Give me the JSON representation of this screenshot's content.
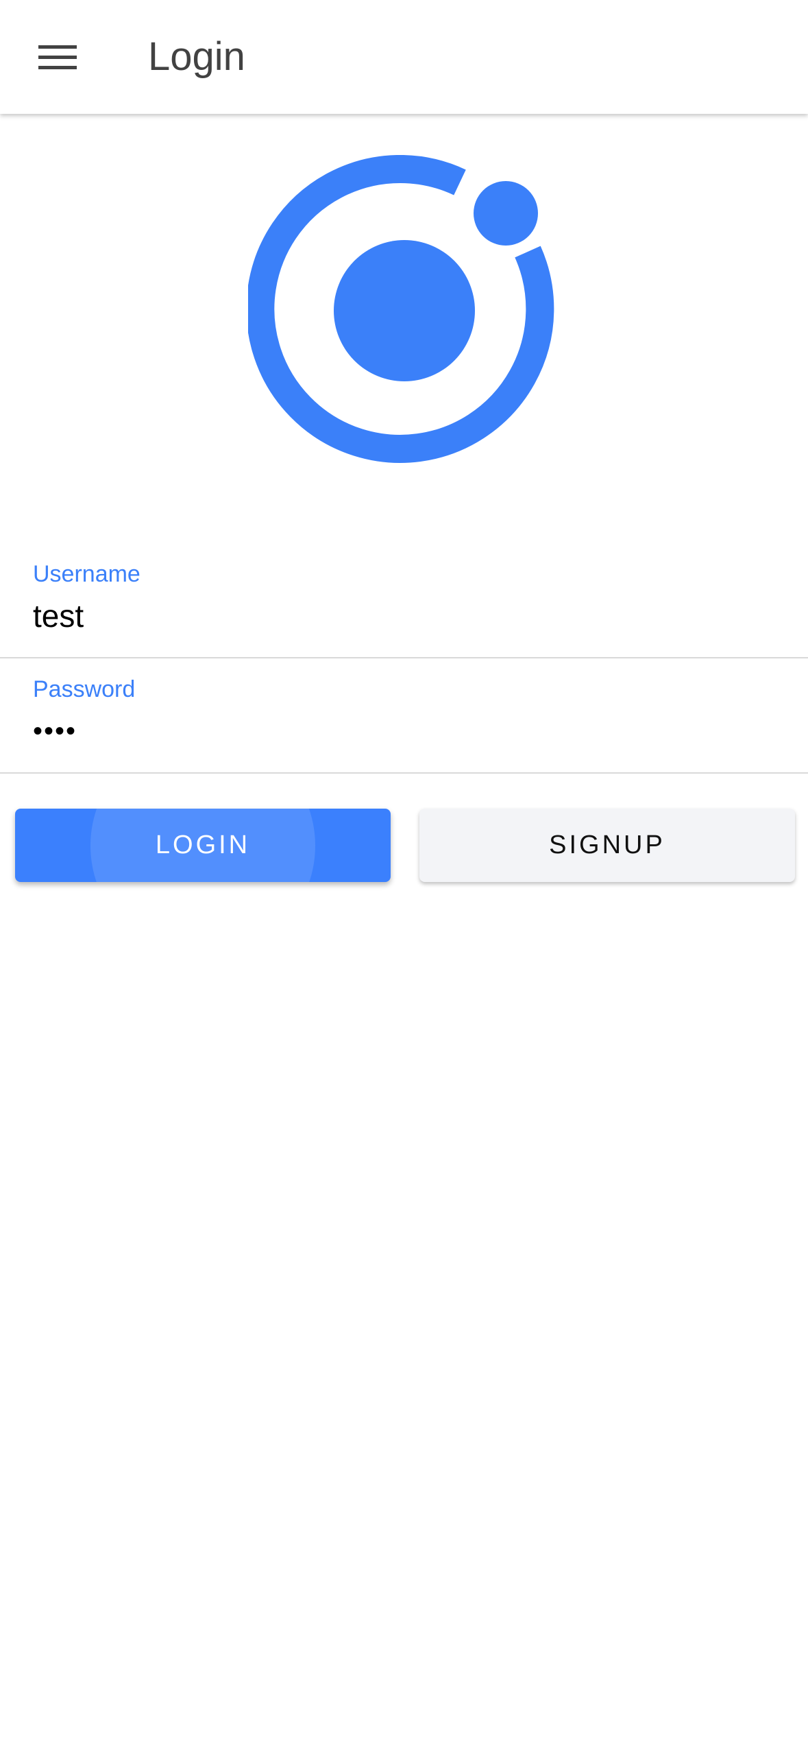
{
  "header": {
    "title": "Login",
    "menu_icon": "hamburger-menu-icon"
  },
  "logo": {
    "icon": "ionic-logo-icon",
    "color": "#3b80f9"
  },
  "form": {
    "username": {
      "label": "Username",
      "value": "test"
    },
    "password": {
      "label": "Password",
      "value": "••••"
    }
  },
  "buttons": {
    "login_label": "LOGIN",
    "signup_label": "SIGNUP"
  },
  "colors": {
    "primary": "#3b80f9",
    "secondary_button": "#f3f4f7",
    "toolbar_text": "#424242"
  }
}
